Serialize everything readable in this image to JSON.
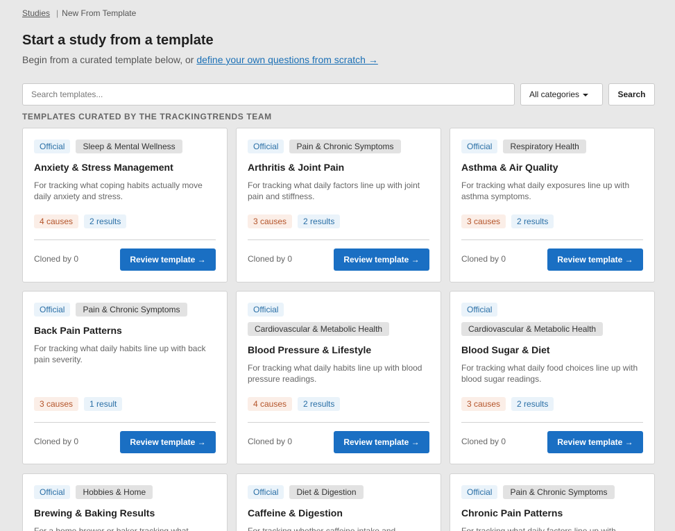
{
  "breadcrumb": {
    "root": "Studies",
    "separator": "|",
    "current": "New From Template"
  },
  "page": {
    "title": "Start a study from a template",
    "subtitle_prefix": "Begin from a curated template below, or ",
    "subtitle_link": "define your own questions from scratch →"
  },
  "search": {
    "placeholder": "Search templates...",
    "value": "",
    "category_selected": "All categories",
    "button_label": "Search"
  },
  "section_heading": "TEMPLATES CURATED BY THE TRACKINGTRENDS TEAM",
  "colors": {
    "accent": "#1a6fc3",
    "link": "#1a6fb5",
    "causes_bg": "#fbeee7",
    "causes_text": "#b4542a",
    "results_bg": "#eaf3fa",
    "results_text": "#2a6fa6"
  },
  "cards": [
    {
      "badge": "Official",
      "category": "Sleep & Mental Wellness",
      "title": "Anxiety & Stress Management",
      "description": "For tracking what coping habits actually move daily anxiety and stress.",
      "causes": "4 causes",
      "results": "2 results",
      "cloned": "Cloned by 0",
      "button": "Review template →"
    },
    {
      "badge": "Official",
      "category": "Pain & Chronic Symptoms",
      "title": "Arthritis & Joint Pain",
      "description": "For tracking what daily factors line up with joint pain and stiffness.",
      "causes": "3 causes",
      "results": "2 results",
      "cloned": "Cloned by 0",
      "button": "Review template →"
    },
    {
      "badge": "Official",
      "category": "Respiratory Health",
      "title": "Asthma & Air Quality",
      "description": "For tracking what daily exposures line up with asthma symptoms.",
      "causes": "3 causes",
      "results": "2 results",
      "cloned": "Cloned by 0",
      "button": "Review template →"
    },
    {
      "badge": "Official",
      "category": "Pain & Chronic Symptoms",
      "title": "Back Pain Patterns",
      "description": "For tracking what daily habits line up with back pain severity.",
      "causes": "3 causes",
      "results": "1 result",
      "cloned": "Cloned by 0",
      "button": "Review template →"
    },
    {
      "badge": "Official",
      "category": "Cardiovascular & Metabolic Health",
      "title": "Blood Pressure & Lifestyle",
      "description": "For tracking what daily habits line up with blood pressure readings.",
      "causes": "4 causes",
      "results": "2 results",
      "cloned": "Cloned by 0",
      "button": "Review template →"
    },
    {
      "badge": "Official",
      "category": "Cardiovascular & Metabolic Health",
      "title": "Blood Sugar & Diet",
      "description": "For tracking what daily food choices line up with blood sugar readings.",
      "causes": "3 causes",
      "results": "2 results",
      "cloned": "Cloned by 0",
      "button": "Review template →"
    },
    {
      "badge": "Official",
      "category": "Hobbies & Home",
      "title": "Brewing & Baking Results",
      "description": "For a home brewer or baker tracking what",
      "causes": "",
      "results": "",
      "cloned": "",
      "button": ""
    },
    {
      "badge": "Official",
      "category": "Diet & Digestion",
      "title": "Caffeine & Digestion",
      "description": "For tracking whether caffeine intake and",
      "causes": "",
      "results": "",
      "cloned": "",
      "button": ""
    },
    {
      "badge": "Official",
      "category": "Pain & Chronic Symptoms",
      "title": "Chronic Pain Patterns",
      "description": "For tracking what daily factors line up with",
      "causes": "",
      "results": "",
      "cloned": "",
      "button": ""
    }
  ]
}
